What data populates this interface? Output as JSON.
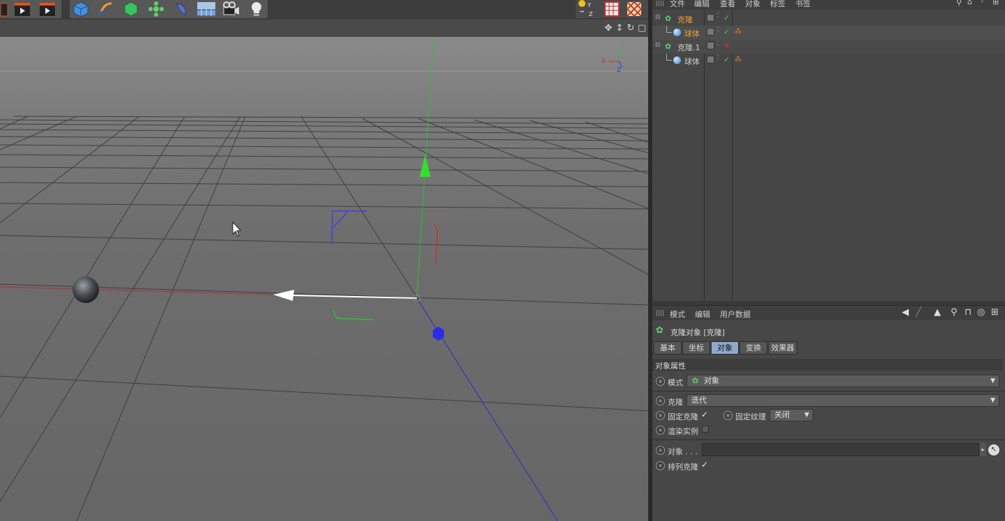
{
  "object_manager": {
    "menu": [
      "文件",
      "编辑",
      "查看",
      "对象",
      "标签",
      "书签"
    ],
    "tree": [
      {
        "name": "克隆",
        "selected": true,
        "status": "check"
      },
      {
        "name": "球体",
        "selected": true,
        "status": "check"
      },
      {
        "name": "克隆.1",
        "selected": false,
        "status": "cross"
      },
      {
        "name": "球体",
        "selected": false,
        "status": "check"
      }
    ]
  },
  "attributes": {
    "menu": [
      "模式",
      "编辑",
      "用户数据"
    ],
    "object_title": "克隆对象 [克隆]",
    "tabs": [
      "基本",
      "坐标",
      "对象",
      "变换",
      "效果器"
    ],
    "active_tab": "对象",
    "section_title": "对象属性",
    "mode_label": "模式",
    "mode_value": "对象",
    "clone_label": "克隆",
    "clone_value": "迭代",
    "fix_clone_label": "固定克隆",
    "fix_clone_checked": true,
    "fix_texture_label": "固定纹理",
    "fix_texture_value": "关闭",
    "render_instances_label": "渲染实例",
    "render_instances_checked": false,
    "object_label": "对象 . . .",
    "object_value": "",
    "arrange_clones_label": "排列克隆",
    "arrange_clones_checked": true
  },
  "viewport": {
    "axis_labels": {
      "x": "X",
      "y": "Y",
      "z": "Z"
    }
  },
  "colors": {
    "accent_orange": "#f0a030",
    "selected_tab": "#8fa8cc",
    "axis_x": "#d03030",
    "axis_y": "#30d030",
    "axis_z": "#3030e0"
  }
}
